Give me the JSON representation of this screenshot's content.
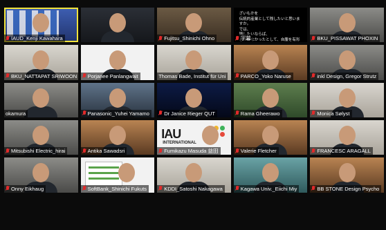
{
  "meeting": {
    "participants": [
      {
        "name": "IAUD_Kenji Kawahara",
        "muted": true,
        "speaking": true,
        "bg": "bg-blue",
        "kind": "banner"
      },
      {
        "name": "",
        "muted": false,
        "speaking": false,
        "bg": "bg-dark",
        "kind": "person"
      },
      {
        "name": "Fujitsu_Shinichi Ohno",
        "muted": true,
        "speaking": false,
        "bg": "bg-shelf",
        "kind": "person"
      },
      {
        "name": "字幕",
        "muted": true,
        "speaking": false,
        "bg": "bg-black",
        "kind": "caption",
        "caption_text": "ざいもかを\n伝統的産業として残したいと思いますか。\nでは、\n残したいならば、\nどうかなかったとして、自腹を有形ですれば\nでして。"
      },
      {
        "name": "BKU_PISSAWAT PHOXIN",
        "muted": true,
        "speaking": false,
        "bg": "bg-office",
        "kind": "person"
      },
      {
        "name": "BKU_NATTAPAT SRIWOON",
        "muted": true,
        "speaking": false,
        "bg": "bg-light",
        "kind": "person"
      },
      {
        "name": "Porjanee Panlangwait",
        "muted": true,
        "speaking": false,
        "bg": "bg-white",
        "kind": "person"
      },
      {
        "name": "Thomas Bade, Institut für Uni",
        "muted": false,
        "speaking": false,
        "bg": "bg-light",
        "kind": "person"
      },
      {
        "name": "PARCO_Yoko Naruse",
        "muted": true,
        "speaking": false,
        "bg": "bg-warm",
        "kind": "person"
      },
      {
        "name": "inkl Design, Gregor Strutz",
        "muted": true,
        "speaking": false,
        "bg": "bg-office",
        "kind": "person"
      },
      {
        "name": "okamura",
        "muted": false,
        "speaking": false,
        "bg": "bg-office",
        "kind": "person"
      },
      {
        "name": "Panasonic_Yuhei Yamamo",
        "muted": true,
        "speaking": false,
        "bg": "bg-city",
        "kind": "person"
      },
      {
        "name": "Dr Janice Rieger QUT",
        "muted": true,
        "speaking": false,
        "bg": "bg-space",
        "kind": "person"
      },
      {
        "name": "Rama Gheerawo",
        "muted": true,
        "speaking": false,
        "bg": "bg-green",
        "kind": "person"
      },
      {
        "name": "Monica Sølyst",
        "muted": true,
        "speaking": false,
        "bg": "bg-light",
        "kind": "person"
      },
      {
        "name": "Mitsubishi Electric_hirai",
        "muted": true,
        "speaking": false,
        "bg": "bg-office",
        "kind": "person"
      },
      {
        "name": "Antika Sawadsri",
        "muted": true,
        "speaking": false,
        "bg": "bg-warm",
        "kind": "person"
      },
      {
        "name": "Fumikazu Masuda 益田",
        "muted": true,
        "speaking": false,
        "bg": "bg-white",
        "kind": "iau",
        "logo_text": "IAU",
        "logo_sub": "INTERNATIONAL"
      },
      {
        "name": "Valerie Fletcher",
        "muted": true,
        "speaking": false,
        "bg": "bg-warm",
        "kind": "person"
      },
      {
        "name": "FRANCESC ARAGALL",
        "muted": true,
        "speaking": false,
        "bg": "bg-light",
        "kind": "person"
      },
      {
        "name": "Onny Eikhaug",
        "muted": true,
        "speaking": false,
        "bg": "bg-office",
        "kind": "person"
      },
      {
        "name": "SoftBank_Shinichi Fukuts",
        "muted": true,
        "speaking": false,
        "bg": "bg-white",
        "kind": "board"
      },
      {
        "name": "KDDI_Satoshi Nakagawa",
        "muted": true,
        "speaking": false,
        "bg": "bg-light",
        "kind": "person"
      },
      {
        "name": "Kagawa Univ._Eiichi Miy",
        "muted": true,
        "speaking": false,
        "bg": "bg-teal",
        "kind": "person"
      },
      {
        "name": "BB STONE Design Psycho",
        "muted": true,
        "speaking": false,
        "bg": "bg-warm",
        "kind": "person"
      }
    ]
  },
  "colors": {
    "speaker_outline": "#f2e33a",
    "muted_icon": "#e02a2a",
    "background": "#0b0b0b"
  }
}
